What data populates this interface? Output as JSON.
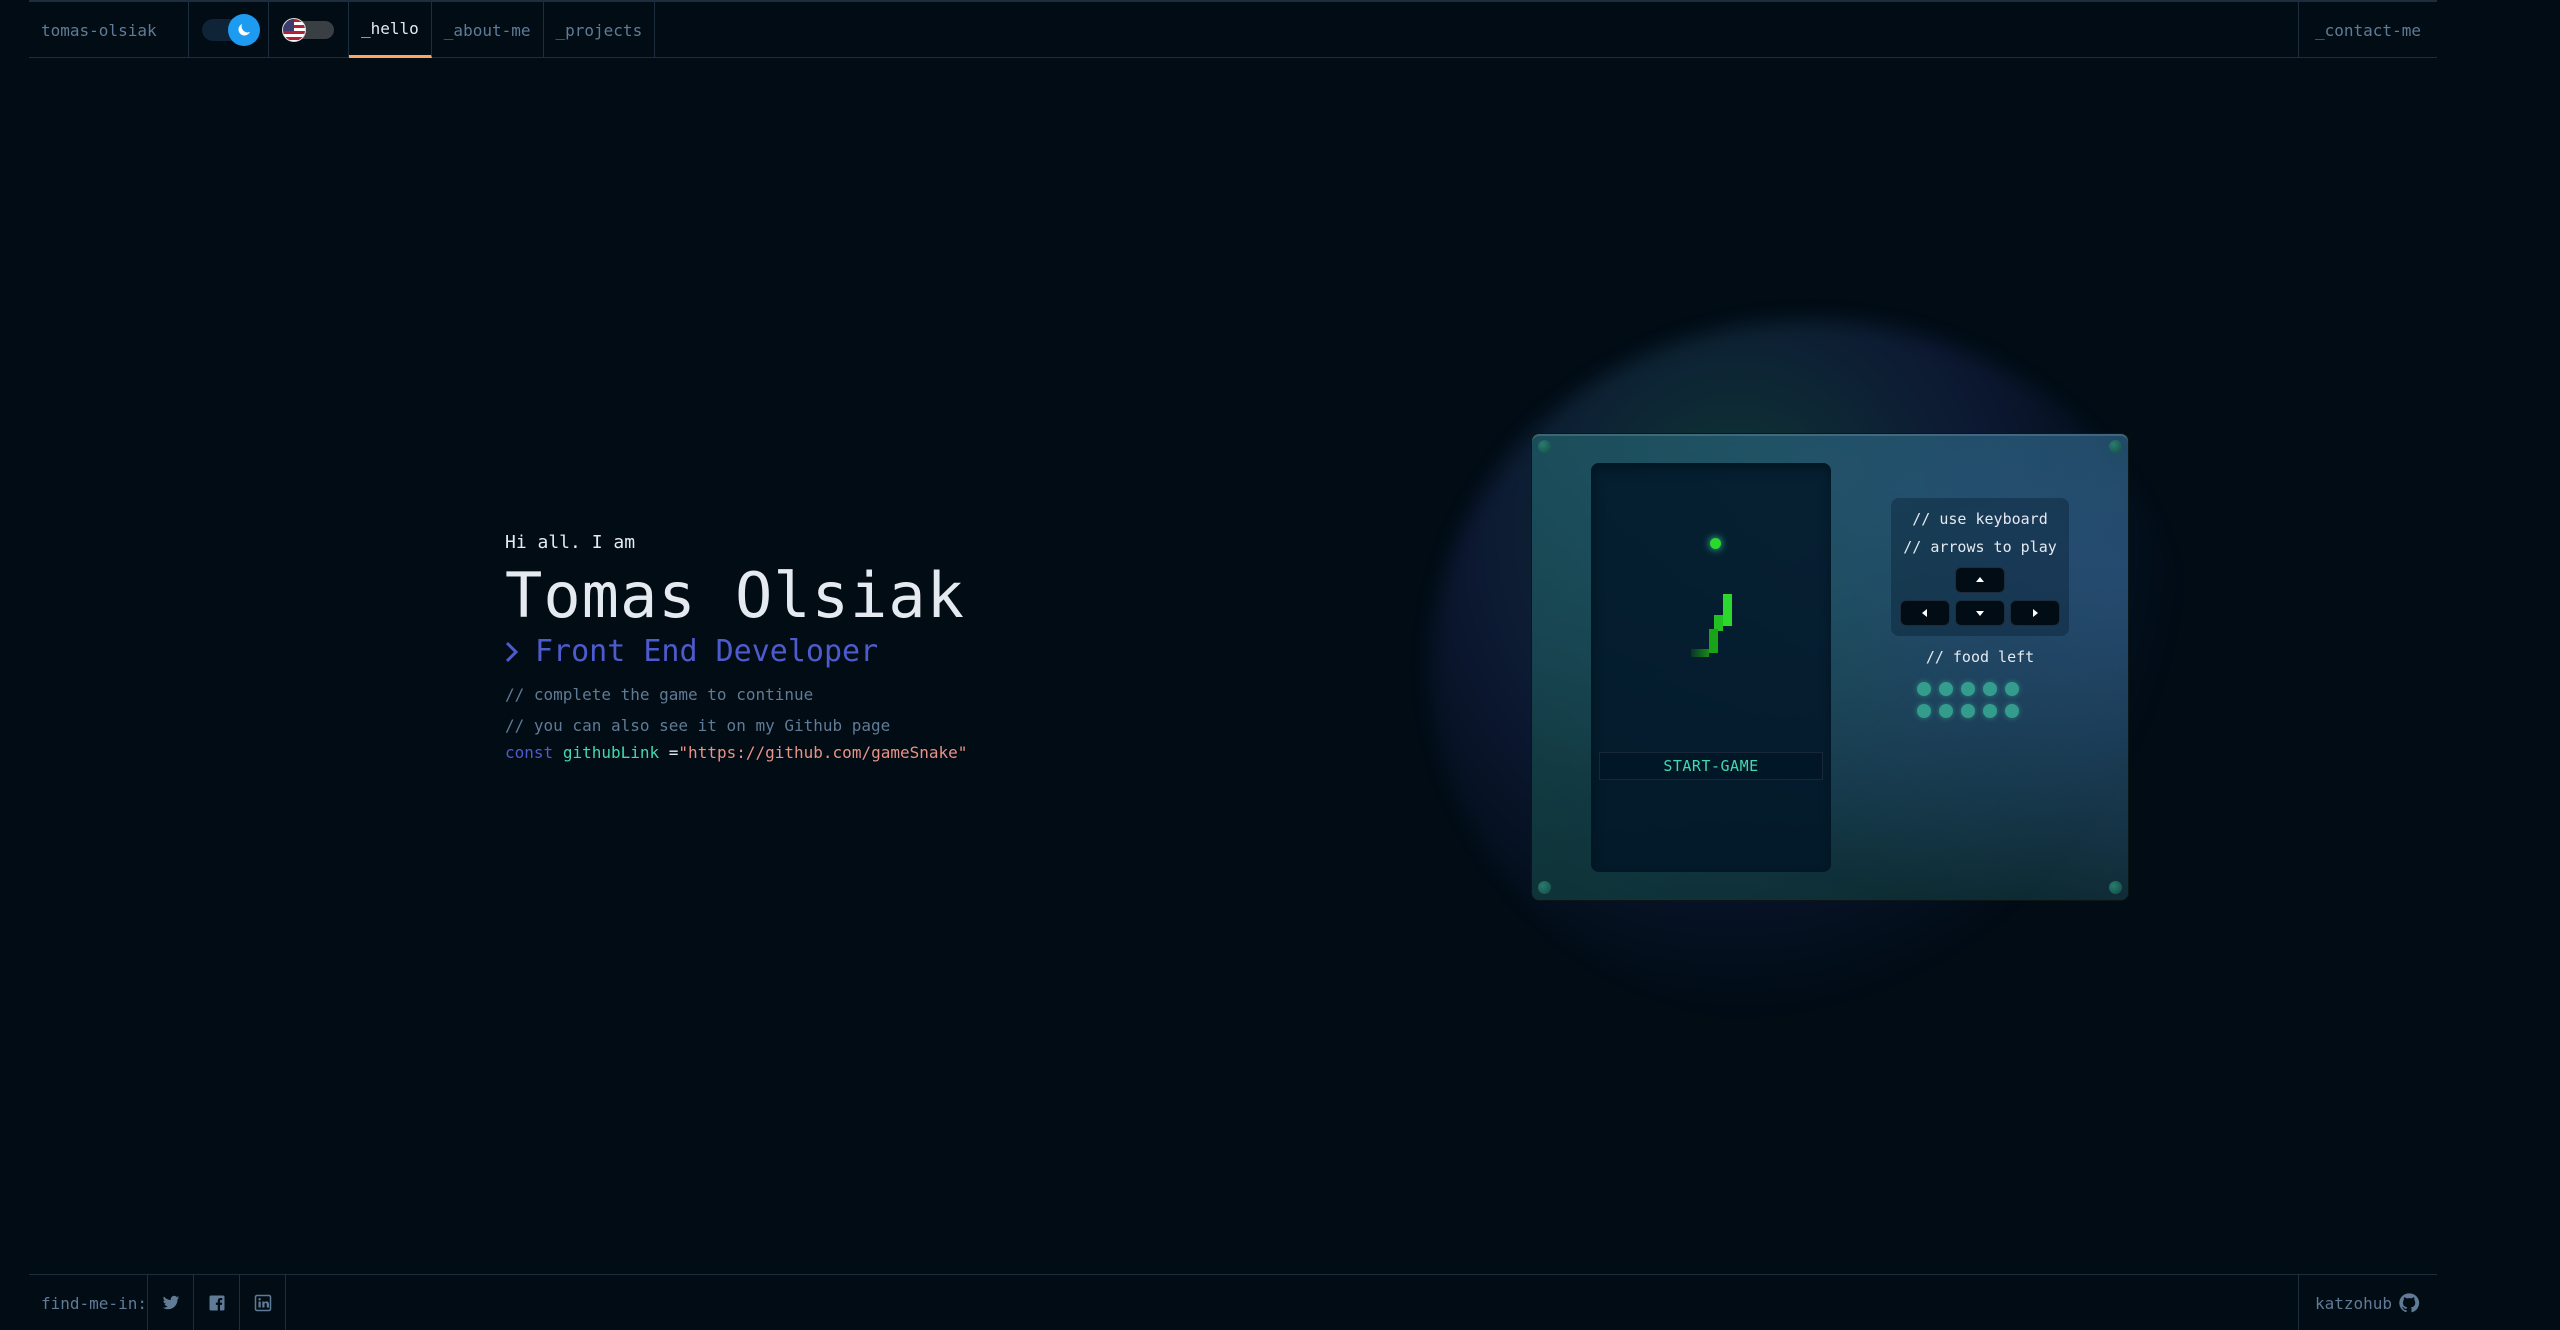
{
  "header": {
    "brand": "tomas-olsiak",
    "tabs": [
      {
        "label": "_hello",
        "active": true
      },
      {
        "label": "_about-me",
        "active": false
      },
      {
        "label": "_projects",
        "active": false
      }
    ],
    "contact": "_contact-me",
    "theme_toggle": "moon-icon",
    "language_toggle": "us-flag-icon"
  },
  "hero": {
    "greeting": "Hi all. I am",
    "name": "Tomas Olsiak",
    "role": "Front End Developer",
    "comment1": "// complete the game to continue",
    "comment2": "// you can also see it on my Github page",
    "code_keyword": "const",
    "code_var": "githubLink",
    "code_eq": "=",
    "code_str": "\"https://github.com/gameSnake\""
  },
  "game": {
    "start_label": "START-GAME",
    "instr1": "// use keyboard",
    "instr2": "// arrows to play",
    "food_label": "// food left",
    "food_count": 10
  },
  "footer": {
    "find": "find-me-in:",
    "socials": [
      "twitter-icon",
      "facebook-icon",
      "linkedin-icon"
    ],
    "github": "katzohub"
  },
  "colors": {
    "bg": "#010c15",
    "accent_orange": "#fea55f",
    "accent_blue": "#4d5bce",
    "accent_green": "#43d9ad",
    "string": "#e99287"
  }
}
